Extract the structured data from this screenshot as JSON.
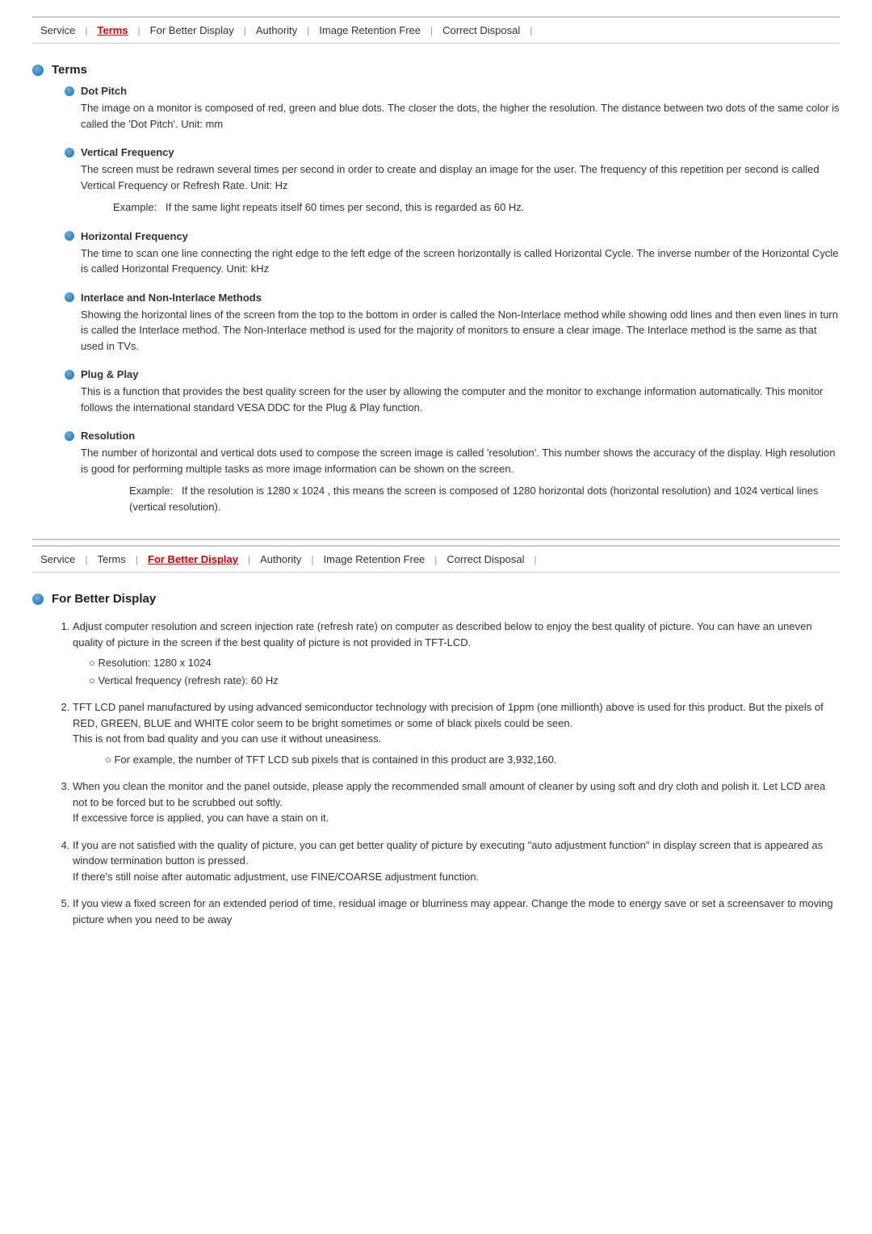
{
  "nav1": {
    "items": [
      {
        "label": "Service",
        "active": false
      },
      {
        "label": "Terms",
        "active": true
      },
      {
        "label": "For Better Display",
        "active": false
      },
      {
        "label": "Authority",
        "active": false
      },
      {
        "label": "Image Retention Free",
        "active": false
      },
      {
        "label": "Correct Disposal",
        "active": false
      }
    ]
  },
  "nav2": {
    "items": [
      {
        "label": "Service",
        "active": false
      },
      {
        "label": "Terms",
        "active": false
      },
      {
        "label": "For Better Display",
        "active": true
      },
      {
        "label": "Authority",
        "active": false
      },
      {
        "label": "Image Retention Free",
        "active": false
      },
      {
        "label": "Correct Disposal",
        "active": false
      }
    ]
  },
  "terms_section": {
    "title": "Terms",
    "subsections": [
      {
        "title": "Dot Pitch",
        "body": "The image on a monitor is composed of red, green and blue dots. The closer the dots, the higher the resolution. The distance between two dots of the same color is called the 'Dot Pitch'. Unit: mm"
      },
      {
        "title": "Vertical Frequency",
        "body": "The screen must be redrawn several times per second in order to create and display an image for the user. The frequency of this repetition per second is called Vertical Frequency or Refresh Rate. Unit: Hz",
        "example": "If the same light repeats itself 60 times per second, this is regarded as 60 Hz."
      },
      {
        "title": "Horizontal Frequency",
        "body": "The time to scan one line connecting the right edge to the left edge of the screen horizontally is called Horizontal Cycle. The inverse number of the Horizontal Cycle is called Horizontal Frequency. Unit: kHz"
      },
      {
        "title": "Interlace and Non-Interlace Methods",
        "body": "Showing the horizontal lines of the screen from the top to the bottom in order is called the Non-Interlace method while showing odd lines and then even lines in turn is called the Interlace method. The Non-Interlace method is used for the majority of monitors to ensure a clear image. The Interlace method is the same as that used in TVs."
      },
      {
        "title": "Plug & Play",
        "body": "This is a function that provides the best quality screen for the user by allowing the computer and the monitor to exchange information automatically. This monitor follows the international standard VESA DDC for the Plug & Play function."
      },
      {
        "title": "Resolution",
        "body": "The number of horizontal and vertical dots used to compose the screen image is called 'resolution'. This number shows the accuracy of the display. High resolution is good for performing multiple tasks as more image information can be shown on the screen.",
        "example": "If the resolution is 1280 x 1024 , this means the screen is composed of 1280 horizontal dots (horizontal resolution) and 1024 vertical lines (vertical resolution)."
      }
    ]
  },
  "for_better_display_section": {
    "title": "For Better Display",
    "items": [
      {
        "body": "Adjust computer resolution and screen injection rate (refresh rate) on computer as described below to enjoy the best quality of picture. You can have an uneven quality of picture in the screen if the best quality of picture is not provided in TFT-LCD.",
        "subitems": [
          "Resolution: 1280 x 1024",
          "Vertical frequency (refresh rate): 60 Hz"
        ]
      },
      {
        "body": "TFT LCD panel manufactured by using advanced semiconductor technology with precision of 1ppm (one millionth) above is used for this product. But the pixels of RED, GREEN, BLUE and WHITE color seem to be bright sometimes or some of black pixels could be seen.\nThis is not from bad quality and you can use it without uneasiness.",
        "subitem": "For example, the number of TFT LCD sub pixels that is contained in this product are 3,932,160."
      },
      {
        "body": "When you clean the monitor and the panel outside, please apply the recommended small amount of cleaner by using soft and dry cloth and polish it. Let LCD area not to be forced but to be scrubbed out softly.\nIf excessive force is applied, you can have a stain on it."
      },
      {
        "body": "If you are not satisfied with the quality of picture, you can get better quality of picture by executing \"auto adjustment function\" in display screen that is appeared as window termination button is pressed.\nIf there's still noise after automatic adjustment, use FINE/COARSE adjustment function."
      },
      {
        "body": "If you view a fixed screen for an extended period of time, residual image or blurriness may appear. Change the mode to energy save or set a screensaver to moving picture when you need to be away"
      }
    ]
  }
}
